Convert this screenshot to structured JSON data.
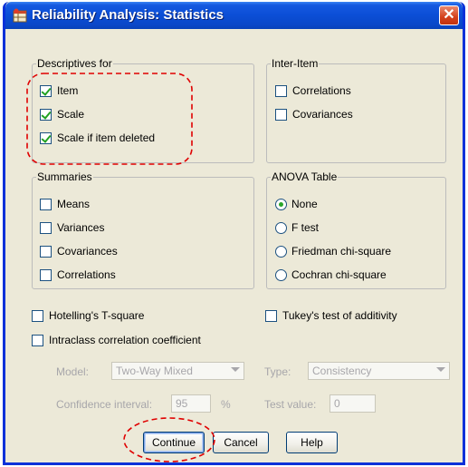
{
  "window": {
    "title": "Reliability Analysis: Statistics",
    "close_glyph": "✕",
    "title_icon": "spss-table-icon"
  },
  "descriptives": {
    "legend": "Descriptives for",
    "items": [
      {
        "label": "Item",
        "checked": true
      },
      {
        "label": "Scale",
        "checked": true
      },
      {
        "label": "Scale if item deleted",
        "checked": true
      }
    ]
  },
  "inter_item": {
    "legend": "Inter-Item",
    "items": [
      {
        "label": "Correlations",
        "checked": false
      },
      {
        "label": "Covariances",
        "checked": false
      }
    ]
  },
  "summaries": {
    "legend": "Summaries",
    "items": [
      {
        "label": "Means",
        "checked": false
      },
      {
        "label": "Variances",
        "checked": false
      },
      {
        "label": "Covariances",
        "checked": false
      },
      {
        "label": "Correlations",
        "checked": false
      }
    ]
  },
  "anova": {
    "legend": "ANOVA Table",
    "options": [
      {
        "label": "None",
        "selected": true
      },
      {
        "label": "F test",
        "selected": false
      },
      {
        "label": "Friedman chi-square",
        "selected": false
      },
      {
        "label": "Cochran chi-square",
        "selected": false
      }
    ]
  },
  "hotelling": {
    "label": "Hotelling's T-square",
    "checked": false
  },
  "tukey": {
    "label": "Tukey's test of additivity",
    "checked": false
  },
  "intraclass": {
    "label": "Intraclass correlation coefficient",
    "checked": false
  },
  "model": {
    "label": "Model:",
    "value": "Two-Way Mixed"
  },
  "type": {
    "label": "Type:",
    "value": "Consistency"
  },
  "confidence": {
    "label": "Confidence interval:",
    "value": "95",
    "unit": "%"
  },
  "test_value": {
    "label": "Test value:",
    "value": "0"
  },
  "buttons": {
    "continue": "Continue",
    "cancel": "Cancel",
    "help": "Help"
  },
  "colors": {
    "annotation": "#e00000",
    "title_bar": "#0b4ed6",
    "dialog_bg": "#ece9d8"
  }
}
